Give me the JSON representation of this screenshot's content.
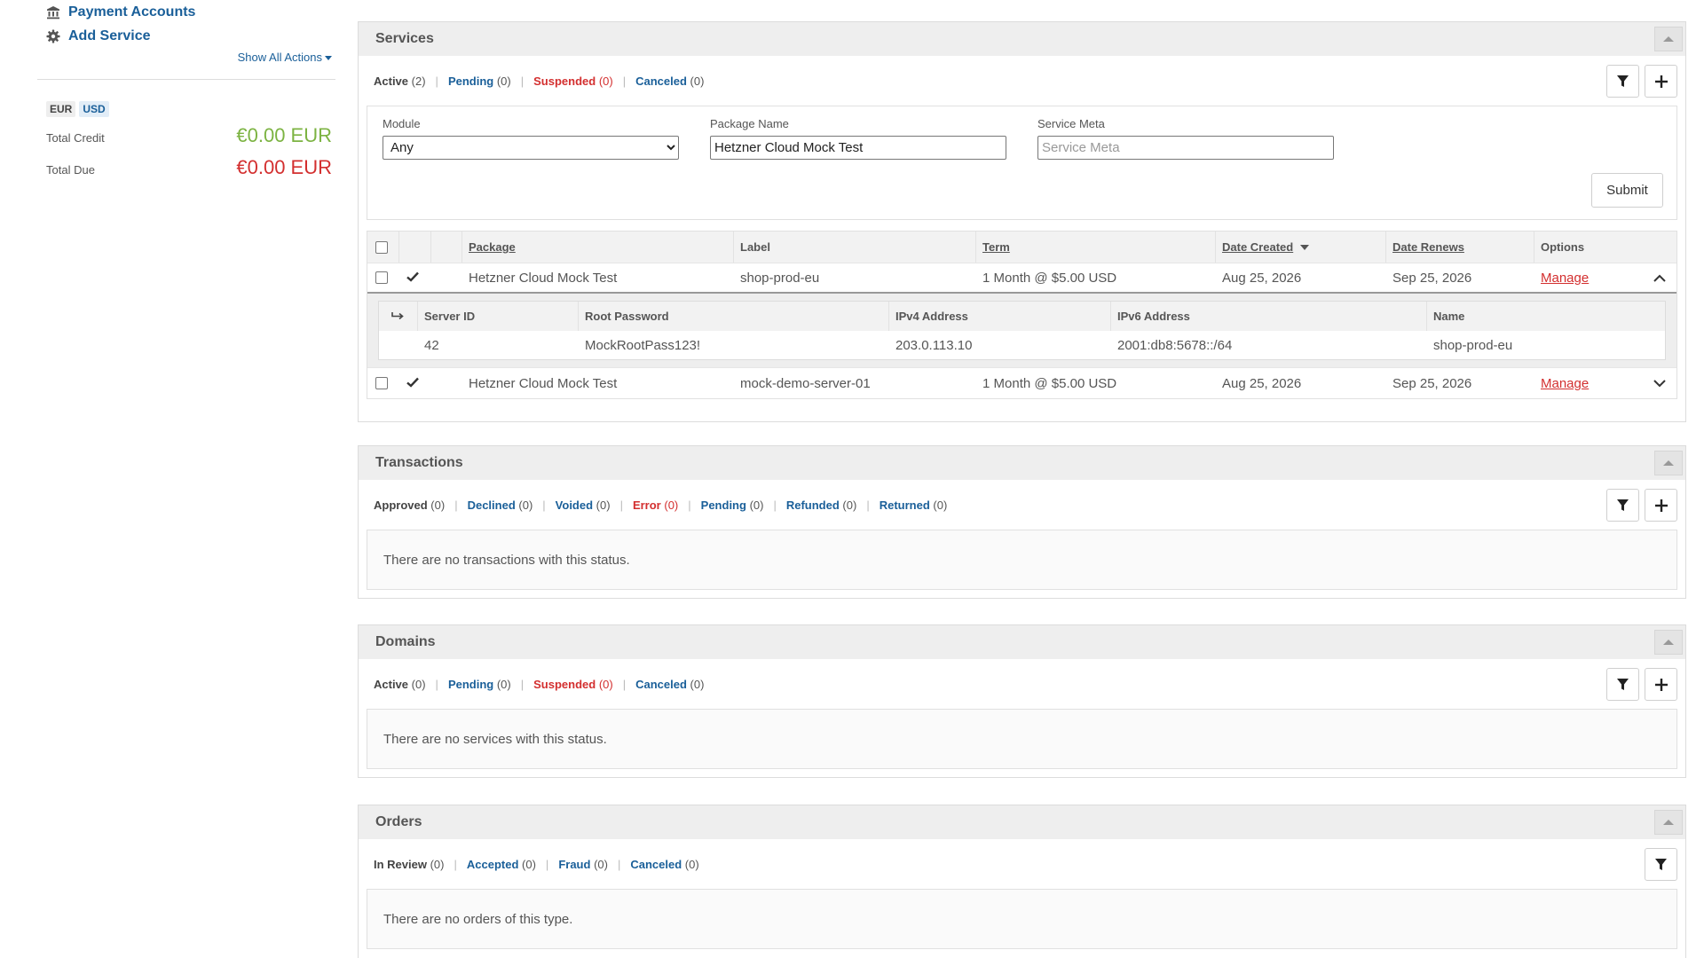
{
  "sidebar": {
    "links": [
      {
        "label": "Payment Accounts",
        "icon": "bank-icon"
      },
      {
        "label": "Add Service",
        "icon": "gear-icon"
      }
    ],
    "show_all_actions": "Show All Actions",
    "currencies": [
      "EUR",
      "USD"
    ],
    "active_currency": "USD",
    "total_credit_label": "Total Credit",
    "total_credit_value": "€0.00 EUR",
    "total_due_label": "Total Due",
    "total_due_value": "€0.00 EUR"
  },
  "services": {
    "title": "Services",
    "statuses": [
      {
        "label": "Active",
        "count": "(2)"
      },
      {
        "label": "Pending",
        "count": "(0)"
      },
      {
        "label": "Suspended",
        "count": "(0)"
      },
      {
        "label": "Canceled",
        "count": "(0)"
      }
    ],
    "filter": {
      "module_label": "Module",
      "module_value": "Any",
      "package_label": "Package Name",
      "package_value": "Hetzner Cloud Mock Test",
      "meta_label": "Service Meta",
      "meta_placeholder": "Service Meta",
      "submit": "Submit"
    },
    "columns": [
      "Package",
      "Label",
      "Term",
      "Date Created",
      "Date Renews",
      "Options"
    ],
    "rows": [
      {
        "package": "Hetzner Cloud Mock Test",
        "label": "shop-prod-eu",
        "term": "1 Month @ $5.00 USD",
        "created": "Aug 25, 2026",
        "renews": "Sep 25, 2026",
        "option": "Manage"
      },
      {
        "package": "Hetzner Cloud Mock Test",
        "label": "mock-demo-server-01",
        "term": "1 Month @ $5.00 USD",
        "created": "Aug 25, 2026",
        "renews": "Sep 25, 2026",
        "option": "Manage"
      }
    ],
    "detail": {
      "columns": [
        "Server ID",
        "Root Password",
        "IPv4 Address",
        "IPv6 Address",
        "Name"
      ],
      "values": [
        "42",
        "MockRootPass123!",
        "203.0.113.10",
        "2001:db8:5678::/64",
        "shop-prod-eu"
      ]
    }
  },
  "transactions": {
    "title": "Transactions",
    "statuses": [
      {
        "label": "Approved",
        "count": "(0)"
      },
      {
        "label": "Declined",
        "count": "(0)"
      },
      {
        "label": "Voided",
        "count": "(0)"
      },
      {
        "label": "Error",
        "count": "(0)"
      },
      {
        "label": "Pending",
        "count": "(0)"
      },
      {
        "label": "Refunded",
        "count": "(0)"
      },
      {
        "label": "Returned",
        "count": "(0)"
      }
    ],
    "empty": "There are no transactions with this status."
  },
  "domains": {
    "title": "Domains",
    "statuses": [
      {
        "label": "Active",
        "count": "(0)"
      },
      {
        "label": "Pending",
        "count": "(0)"
      },
      {
        "label": "Suspended",
        "count": "(0)"
      },
      {
        "label": "Canceled",
        "count": "(0)"
      }
    ],
    "empty": "There are no services with this status."
  },
  "orders": {
    "title": "Orders",
    "statuses": [
      {
        "label": "In Review",
        "count": "(0)"
      },
      {
        "label": "Accepted",
        "count": "(0)"
      },
      {
        "label": "Fraud",
        "count": "(0)"
      },
      {
        "label": "Canceled",
        "count": "(0)"
      }
    ],
    "empty": "There are no orders of this type."
  },
  "colors": {
    "link": "#1a5f99",
    "danger": "#d32f2f",
    "credit": "#7cb342"
  }
}
